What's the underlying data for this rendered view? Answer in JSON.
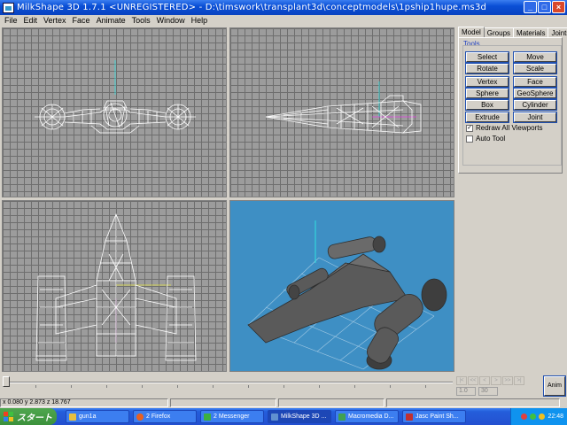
{
  "window": {
    "title": "MilkShape 3D 1.7.1 <UNREGISTERED> - D:\\timswork\\transplant3d\\conceptmodels\\1pship1hupe.ms3d",
    "buttons": [
      "_",
      "□",
      "×"
    ]
  },
  "menu": {
    "items": [
      "File",
      "Edit",
      "Vertex",
      "Face",
      "Animate",
      "Tools",
      "Window",
      "Help"
    ]
  },
  "panel": {
    "tabs": [
      "Model",
      "Groups",
      "Materials",
      "Joints"
    ],
    "active_tab": "Model",
    "group_label": "Tools",
    "tool_buttons": [
      [
        "Select",
        "Move"
      ],
      [
        "Rotate",
        "Scale"
      ],
      [
        "Vertex",
        "Face"
      ],
      [
        "Sphere",
        "GeoSphere"
      ],
      [
        "Box",
        "Cylinder"
      ],
      [
        "Extrude",
        "Joint"
      ]
    ],
    "checkboxes": [
      {
        "label": "Redraw All Viewports",
        "checked": true
      },
      {
        "label": "Auto Tool",
        "checked": false
      }
    ]
  },
  "timeline": {
    "start_frame": "1.0",
    "end_frame": "30",
    "anim_label": "Anim",
    "nav": [
      "|<",
      "<<",
      "<",
      ">",
      ">>",
      ">|"
    ]
  },
  "status": {
    "coords": "x 0.080 y 2.873 z 18.767"
  },
  "taskbar": {
    "start_label": "スタート",
    "tasks": [
      {
        "label": "gun1a",
        "color": "#e8c040"
      },
      {
        "label": "2 Firefox",
        "color": "#e86020"
      },
      {
        "label": "2 Messenger",
        "color": "#3cb040"
      },
      {
        "label": "MilkShape 3D ...",
        "color": "#6090d0",
        "active": true
      },
      {
        "label": "Macromedia D...",
        "color": "#40a050"
      },
      {
        "label": "Jasc Paint Sh...",
        "color": "#c03030"
      }
    ],
    "clock": "22:48"
  },
  "colors": {
    "viewport_grid": "#9c9c9c",
    "viewport_3d": "#3e8fc4",
    "wireframe": "#ffffff",
    "axis_y": "#30e0e0",
    "axis_x": "#e040e0",
    "axis_z": "#e0e040"
  }
}
